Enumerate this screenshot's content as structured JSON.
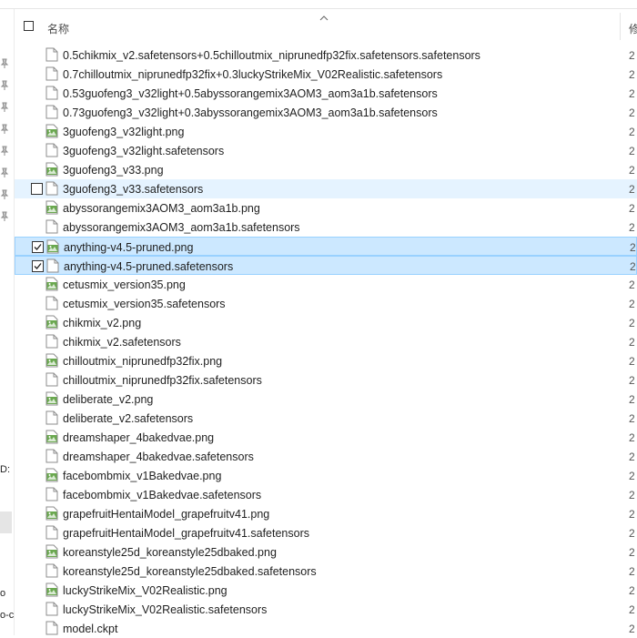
{
  "header": {
    "name_label": "名称",
    "next_column_label": "修"
  },
  "left_pane": {
    "label_1": "D:",
    "label_2": "o",
    "label_3": "o-c"
  },
  "files": [
    {
      "name": "0.5chikmix_v2.safetensors+0.5chilloutmix_niprunedfp32fix.safetensors.safetensors",
      "type": "file",
      "col2": "2"
    },
    {
      "name": "0.7chilloutmix_niprunedfp32fix+0.3luckyStrikeMix_V02Realistic.safetensors",
      "type": "file",
      "col2": "2"
    },
    {
      "name": "0.53guofeng3_v32light+0.5abyssorangemix3AOM3_aom3a1b.safetensors",
      "type": "file",
      "col2": "2"
    },
    {
      "name": "0.73guofeng3_v32light+0.3abyssorangemix3AOM3_aom3a1b.safetensors",
      "type": "file",
      "col2": "2"
    },
    {
      "name": "3guofeng3_v32light.png",
      "type": "png",
      "col2": "2"
    },
    {
      "name": "3guofeng3_v32light.safetensors",
      "type": "file",
      "col2": "2"
    },
    {
      "name": "3guofeng3_v33.png",
      "type": "png",
      "col2": "2"
    },
    {
      "name": "3guofeng3_v33.safetensors",
      "type": "file",
      "col2": "2",
      "state": "hover",
      "checkbox": "unchecked"
    },
    {
      "name": "abyssorangemix3AOM3_aom3a1b.png",
      "type": "png",
      "col2": "2"
    },
    {
      "name": "abyssorangemix3AOM3_aom3a1b.safetensors",
      "type": "file",
      "col2": "2"
    },
    {
      "name": "anything-v4.5-pruned.png",
      "type": "png",
      "col2": "2",
      "state": "selected",
      "checkbox": "checked"
    },
    {
      "name": "anything-v4.5-pruned.safetensors",
      "type": "file",
      "col2": "2",
      "state": "selected",
      "checkbox": "checked"
    },
    {
      "name": "cetusmix_version35.png",
      "type": "png",
      "col2": "2"
    },
    {
      "name": "cetusmix_version35.safetensors",
      "type": "file",
      "col2": "2"
    },
    {
      "name": "chikmix_v2.png",
      "type": "png",
      "col2": "2"
    },
    {
      "name": "chikmix_v2.safetensors",
      "type": "file",
      "col2": "2"
    },
    {
      "name": "chilloutmix_niprunedfp32fix.png",
      "type": "png",
      "col2": "2"
    },
    {
      "name": "chilloutmix_niprunedfp32fix.safetensors",
      "type": "file",
      "col2": "2"
    },
    {
      "name": "deliberate_v2.png",
      "type": "png",
      "col2": "2"
    },
    {
      "name": "deliberate_v2.safetensors",
      "type": "file",
      "col2": "2"
    },
    {
      "name": "dreamshaper_4bakedvae.png",
      "type": "png",
      "col2": "2"
    },
    {
      "name": "dreamshaper_4bakedvae.safetensors",
      "type": "file",
      "col2": "2"
    },
    {
      "name": "facebombmix_v1Bakedvae.png",
      "type": "png",
      "col2": "2"
    },
    {
      "name": "facebombmix_v1Bakedvae.safetensors",
      "type": "file",
      "col2": "2"
    },
    {
      "name": "grapefruitHentaiModel_grapefruitv41.png",
      "type": "png",
      "col2": "2"
    },
    {
      "name": "grapefruitHentaiModel_grapefruitv41.safetensors",
      "type": "file",
      "col2": "2"
    },
    {
      "name": "koreanstyle25d_koreanstyle25dbaked.png",
      "type": "png",
      "col2": "2"
    },
    {
      "name": "koreanstyle25d_koreanstyle25dbaked.safetensors",
      "type": "file",
      "col2": "2"
    },
    {
      "name": "luckyStrikeMix_V02Realistic.png",
      "type": "png",
      "col2": "2"
    },
    {
      "name": "luckyStrikeMix_V02Realistic.safetensors",
      "type": "file",
      "col2": "2"
    },
    {
      "name": "model.ckpt",
      "type": "file",
      "col2": "2"
    }
  ],
  "icons": {
    "png": "image-file-icon",
    "file": "blank-file-icon",
    "pin": "pin-icon",
    "sort": "sort-ascending-icon"
  },
  "colors": {
    "selected_bg": "#cce8ff",
    "selected_border": "#99d1ff",
    "hover_bg": "#e5f3ff",
    "png_icon_green": "#6aa84f"
  }
}
